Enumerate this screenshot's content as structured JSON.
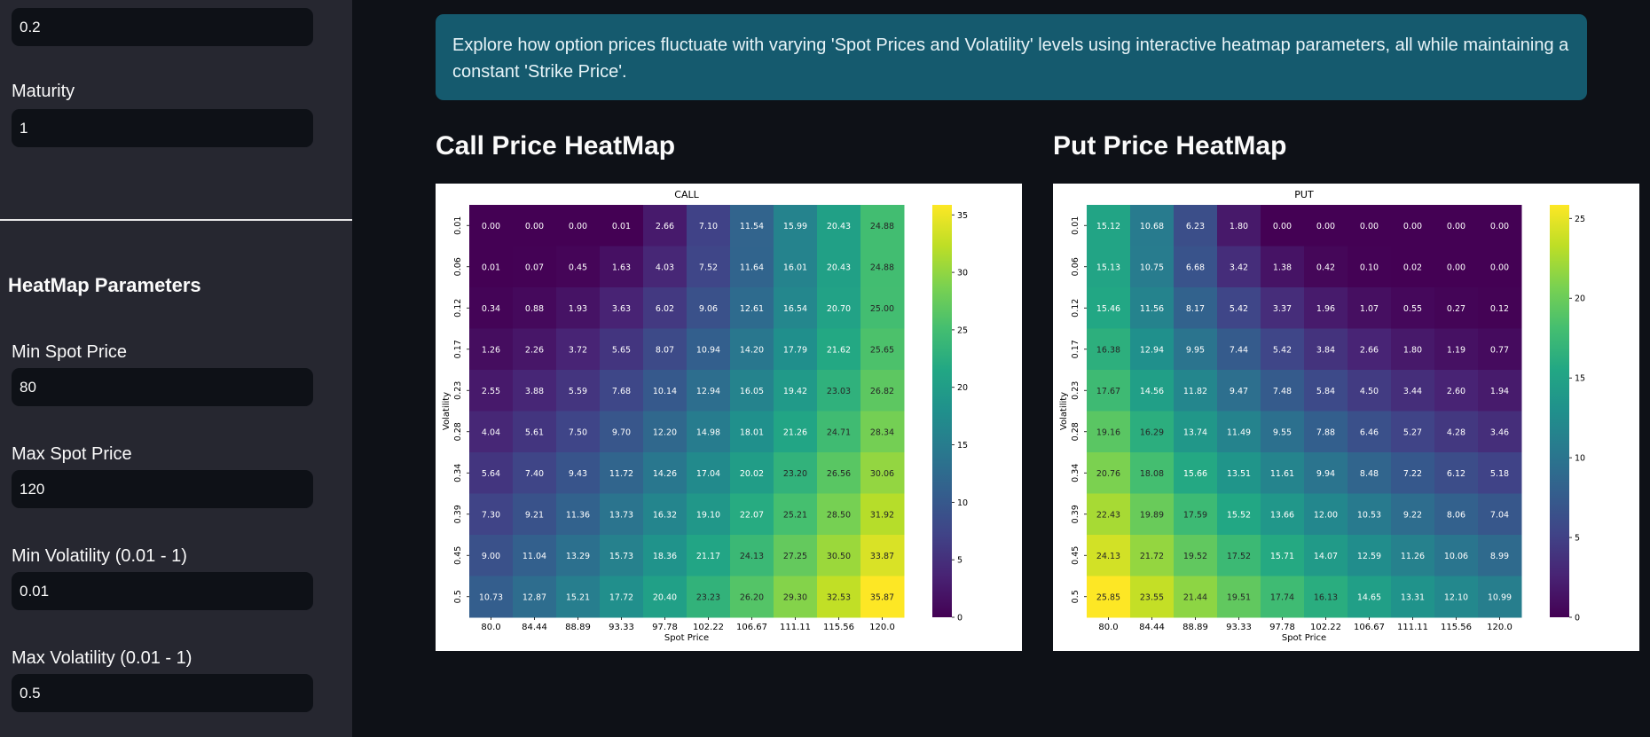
{
  "sidebar": {
    "top_value": "0.2",
    "maturity_label": "Maturity",
    "maturity_value": "1",
    "section_title": "HeatMap Parameters",
    "min_spot_label": "Min Spot Price",
    "min_spot_value": "80",
    "max_spot_label": "Max Spot Price",
    "max_spot_value": "120",
    "min_vol_label": "Min Volatility (0.01 - 1)",
    "min_vol_value": "0.01",
    "max_vol_label": "Max Volatility (0.01 - 1)",
    "max_vol_value": "0.5"
  },
  "info": {
    "text": "Explore how option prices fluctuate with varying 'Spot Prices and Volatility' levels using interactive heatmap parameters, all while maintaining a constant 'Strike Price'."
  },
  "call_section": {
    "title": "Call Price HeatMap"
  },
  "put_section": {
    "title": "Put Price HeatMap"
  },
  "chart_data": [
    {
      "type": "heatmap",
      "title": "CALL",
      "xlabel": "Spot Price",
      "ylabel": "Volatility",
      "x": [
        "80.0",
        "84.44",
        "88.89",
        "93.33",
        "97.78",
        "102.22",
        "106.67",
        "111.11",
        "115.56",
        "120.0"
      ],
      "y": [
        "0.01",
        "0.06",
        "0.12",
        "0.17",
        "0.23",
        "0.28",
        "0.34",
        "0.39",
        "0.45",
        "0.5"
      ],
      "colorscale": "viridis",
      "colorbar_range": [
        0,
        35.87
      ],
      "colorbar_ticks": [
        0,
        5,
        10,
        15,
        20,
        25,
        30,
        35
      ],
      "values": [
        [
          0.0,
          0.0,
          0.0,
          0.01,
          2.66,
          7.1,
          11.54,
          15.99,
          20.43,
          24.88
        ],
        [
          0.01,
          0.07,
          0.45,
          1.63,
          4.03,
          7.52,
          11.64,
          16.01,
          20.43,
          24.88
        ],
        [
          0.34,
          0.88,
          1.93,
          3.63,
          6.02,
          9.06,
          12.61,
          16.54,
          20.7,
          25.0
        ],
        [
          1.26,
          2.26,
          3.72,
          5.65,
          8.07,
          10.94,
          14.2,
          17.79,
          21.62,
          25.65
        ],
        [
          2.55,
          3.88,
          5.59,
          7.68,
          10.14,
          12.94,
          16.05,
          19.42,
          23.03,
          26.82
        ],
        [
          4.04,
          5.61,
          7.5,
          9.7,
          12.2,
          14.98,
          18.01,
          21.26,
          24.71,
          28.34
        ],
        [
          5.64,
          7.4,
          9.43,
          11.72,
          14.26,
          17.04,
          20.02,
          23.2,
          26.56,
          30.06
        ],
        [
          7.3,
          9.21,
          11.36,
          13.73,
          16.32,
          19.1,
          22.07,
          25.21,
          28.5,
          31.92
        ],
        [
          9.0,
          11.04,
          13.29,
          15.73,
          18.36,
          21.17,
          24.13,
          27.25,
          30.5,
          33.87
        ],
        [
          10.73,
          12.87,
          15.21,
          17.72,
          20.4,
          23.23,
          26.2,
          29.3,
          32.53,
          35.87
        ]
      ]
    },
    {
      "type": "heatmap",
      "title": "PUT",
      "xlabel": "Spot Price",
      "ylabel": "Volatility",
      "x": [
        "80.0",
        "84.44",
        "88.89",
        "93.33",
        "97.78",
        "102.22",
        "106.67",
        "111.11",
        "115.56",
        "120.0"
      ],
      "y": [
        "0.01",
        "0.06",
        "0.12",
        "0.17",
        "0.23",
        "0.28",
        "0.34",
        "0.39",
        "0.45",
        "0.5"
      ],
      "colorscale": "viridis",
      "colorbar_range": [
        0,
        25.85
      ],
      "colorbar_ticks": [
        0,
        5,
        10,
        15,
        20,
        25
      ],
      "values": [
        [
          15.12,
          10.68,
          6.23,
          1.8,
          0.0,
          0.0,
          0.0,
          0.0,
          0.0,
          0.0
        ],
        [
          15.13,
          10.75,
          6.68,
          3.42,
          1.38,
          0.42,
          0.1,
          0.02,
          0.0,
          0.0
        ],
        [
          15.46,
          11.56,
          8.17,
          5.42,
          3.37,
          1.96,
          1.07,
          0.55,
          0.27,
          0.12
        ],
        [
          16.38,
          12.94,
          9.95,
          7.44,
          5.42,
          3.84,
          2.66,
          1.8,
          1.19,
          0.77
        ],
        [
          17.67,
          14.56,
          11.82,
          9.47,
          7.48,
          5.84,
          4.5,
          3.44,
          2.6,
          1.94
        ],
        [
          19.16,
          16.29,
          13.74,
          11.49,
          9.55,
          7.88,
          6.46,
          5.27,
          4.28,
          3.46
        ],
        [
          20.76,
          18.08,
          15.66,
          13.51,
          11.61,
          9.94,
          8.48,
          7.22,
          6.12,
          5.18
        ],
        [
          22.43,
          19.89,
          17.59,
          15.52,
          13.66,
          12.0,
          10.53,
          9.22,
          8.06,
          7.04
        ],
        [
          24.13,
          21.72,
          19.52,
          17.52,
          15.71,
          14.07,
          12.59,
          11.26,
          10.06,
          8.99
        ],
        [
          25.85,
          23.55,
          21.44,
          19.51,
          17.74,
          16.13,
          14.65,
          13.31,
          12.1,
          10.99
        ]
      ]
    }
  ]
}
